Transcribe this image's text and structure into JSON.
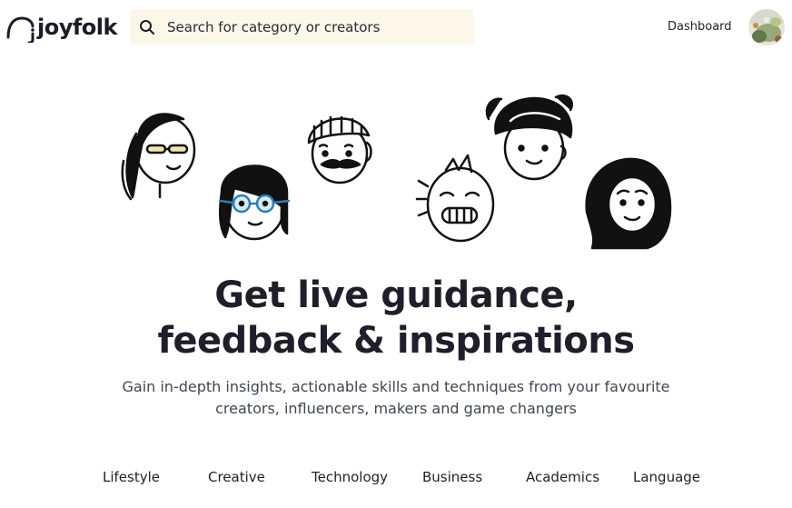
{
  "header": {
    "logo_text": "joyfolk",
    "search_placeholder": "Search for category or creators",
    "dashboard_label": "Dashboard"
  },
  "hero": {
    "headline_line1": "Get live guidance,",
    "headline_line2": "feedback & inspirations",
    "subtitle_line1": "Gain in-depth insights, actionable skills and techniques from your favourite",
    "subtitle_line2": "creators, influencers, makers and game changers"
  },
  "categories": [
    "Lifestyle",
    "Creative",
    "Technology",
    "Business",
    "Academics",
    "Language"
  ],
  "icons": [
    "search-icon",
    "logo-mark-icon",
    "avatar"
  ]
}
